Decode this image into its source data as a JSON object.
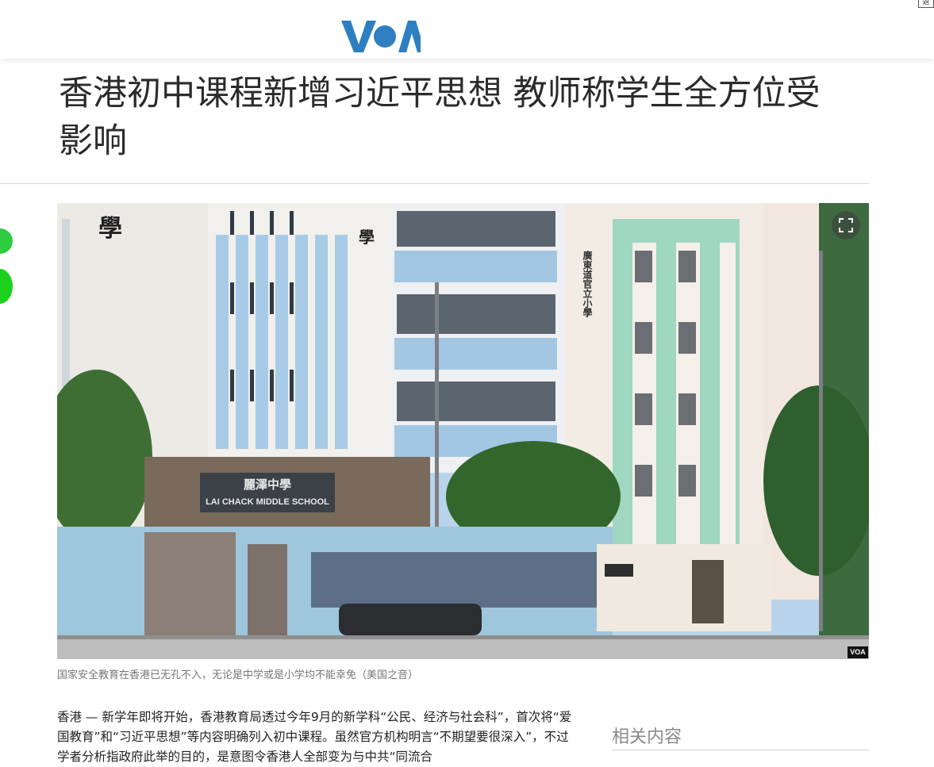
{
  "header": {
    "logo": "VOA",
    "corner_label": "返"
  },
  "article": {
    "title": "香港初中课程新增习近平思想 教师称学生全方位受影响",
    "image": {
      "school_sign_chinese": "麗澤中學",
      "school_sign_english": "LAI CHACK MIDDLE SCHOOL",
      "vertical_sign": "廣東道官立小學",
      "building_char": "學",
      "watermark": "VOA"
    },
    "caption": "国家安全教育在香港已无孔不入，无论是中学或是小学均不能幸免（美国之音）",
    "body": "香港 — 新学年即将开始，香港教育局透过今年9月的新学科“公民、经济与社会科”，首次将“爱国教育”和“习近平思想”等内容明确列入初中课程。虽然官方机构明言“不期望要很深入”，不过学者分析指政府此举的目的，是意图令香港人全部变为与中共“同流合"
  },
  "sidebar": {
    "related_heading": "相关内容"
  },
  "share": {
    "icons": [
      "share-green-icon",
      "line-icon"
    ]
  },
  "colors": {
    "brand": "#2e7fc1"
  }
}
